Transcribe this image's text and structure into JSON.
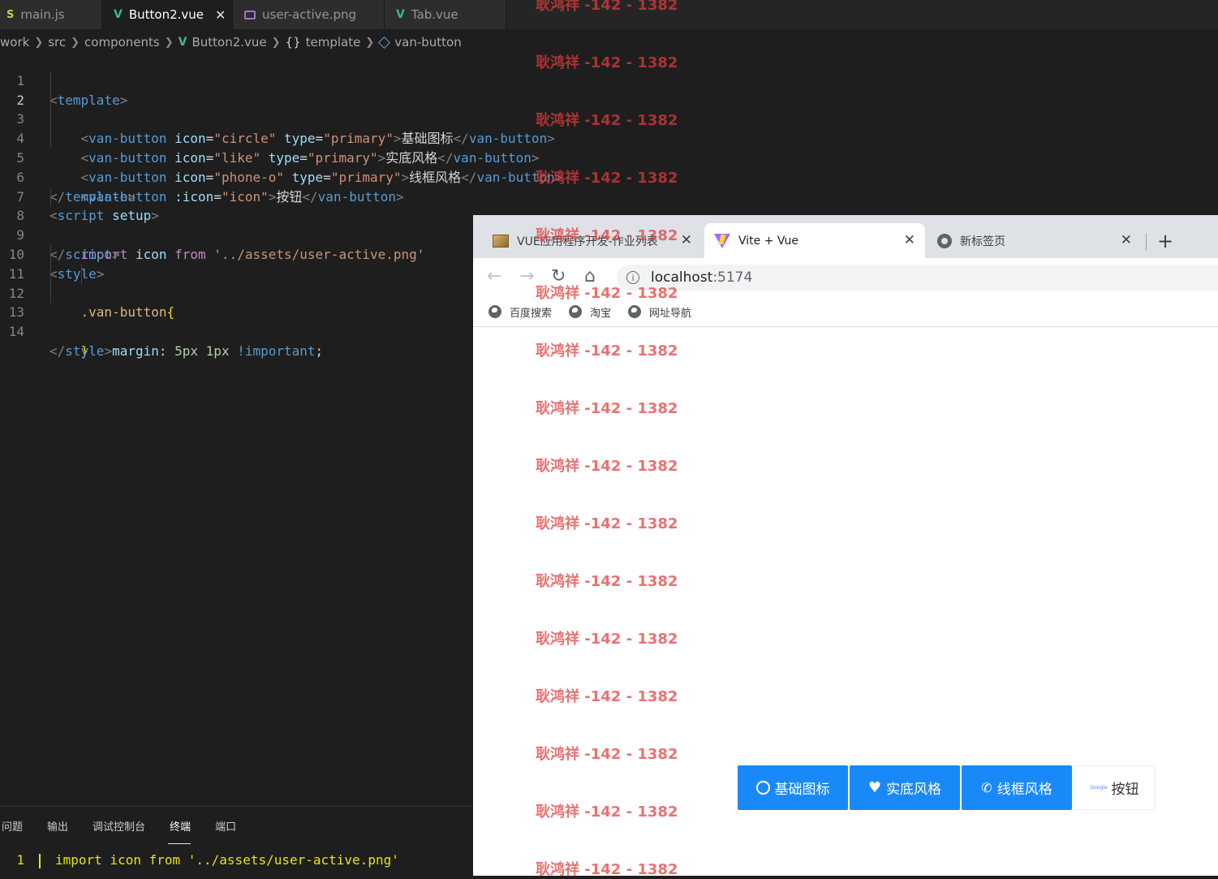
{
  "editor": {
    "tabs": [
      {
        "label": "main.js",
        "icon": "js-icon"
      },
      {
        "label": "Button2.vue",
        "icon": "vue-icon",
        "active": true
      },
      {
        "label": "user-active.png",
        "icon": "image-icon"
      },
      {
        "label": "Tab.vue",
        "icon": "vue-icon"
      }
    ],
    "close_glyph": "✕",
    "breadcrumb": [
      "work",
      "src",
      "components",
      "Button2.vue",
      "template",
      "van-button"
    ],
    "code": {
      "line_numbers": [
        "1",
        "2",
        "3",
        "4",
        "5",
        "6",
        "7",
        "8",
        "9",
        "10",
        "11",
        "12",
        "13",
        "14"
      ],
      "current_line": "2"
    }
  },
  "panel": {
    "tabs": [
      "问题",
      "输出",
      "调试控制台",
      "终端",
      "端口"
    ],
    "active_tab": "终端",
    "terminal": {
      "line_number": "1",
      "text": "import icon from '../assets/user-active.png'"
    }
  },
  "browser": {
    "tabs": [
      {
        "title": "VUE应用程序开发-作业列表",
        "favicon": "image-favicon"
      },
      {
        "title": "Vite + Vue",
        "favicon": "vite-favicon",
        "active": true
      },
      {
        "title": "新标签页",
        "favicon": "chrome-favicon"
      }
    ],
    "new_tab_glyph": "+",
    "url_host": "localhost",
    "url_port": ":5174",
    "bookmarks": [
      "百度搜索",
      "淘宝",
      "网址导航"
    ],
    "buttons": [
      {
        "label": "基础图标",
        "type": "primary",
        "icon": "circle"
      },
      {
        "label": "实底风格",
        "type": "primary",
        "icon": "like"
      },
      {
        "label": "线框风格",
        "type": "primary",
        "icon": "phone-o"
      },
      {
        "label": "按钮",
        "type": "default",
        "icon": "image"
      }
    ],
    "button_image_text": "Google"
  },
  "watermark": {
    "text": "耿鸿祥 -142 - 1382"
  },
  "colors": {
    "primary": "#1989fa",
    "editor_bg": "#1e1e1e",
    "watermark": "#e03c3c"
  }
}
